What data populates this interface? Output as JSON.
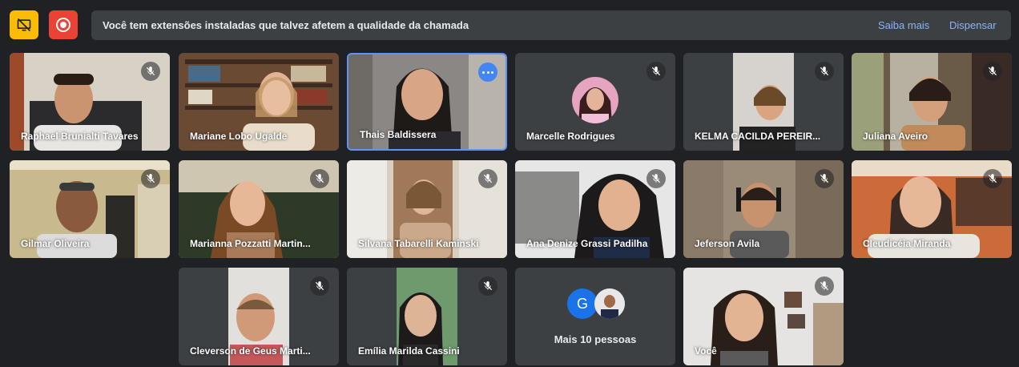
{
  "banner": {
    "message": "Você tem extensões instaladas que talvez afetem a qualidade da chamada",
    "learn_more": "Saiba mais",
    "dismiss": "Dispensar"
  },
  "participants": {
    "p1": "Raphael Brunialti Tavares",
    "p2": "Mariane Lobo Ugalde",
    "p3": "Thais Baldissera",
    "p4": "Marcelle Rodrigues",
    "p5": "KELMA CACILDA PEREIR...",
    "p6": "Juliana Aveiro",
    "p7": "Gilmar Oliveira",
    "p8": "Marianna Pozzatti Martin...",
    "p9": "Silvana Tabarelli Kaminski",
    "p10": "Ana Denize Grassi Padilha",
    "p11": "Jeferson Avila",
    "p12": "Cleudicéia Miranda",
    "p13": "Cleverson de Geus Marti...",
    "p14": "Emília Marilda Cassini",
    "p15": "Você"
  },
  "more_people": {
    "initial": "G",
    "label": "Mais 10 pessoas"
  },
  "icons": {
    "present": "present-off-icon",
    "record": "record-icon",
    "mic_off": "mic-off-icon",
    "more": "more-options-icon"
  },
  "colors": {
    "background": "#202124",
    "tile": "#3c4043",
    "present_button": "#fbbc04",
    "record_button": "#ea4335",
    "link": "#8ab4f8",
    "active_border": "#5f93f5",
    "avatar_blue": "#1a73e8"
  }
}
